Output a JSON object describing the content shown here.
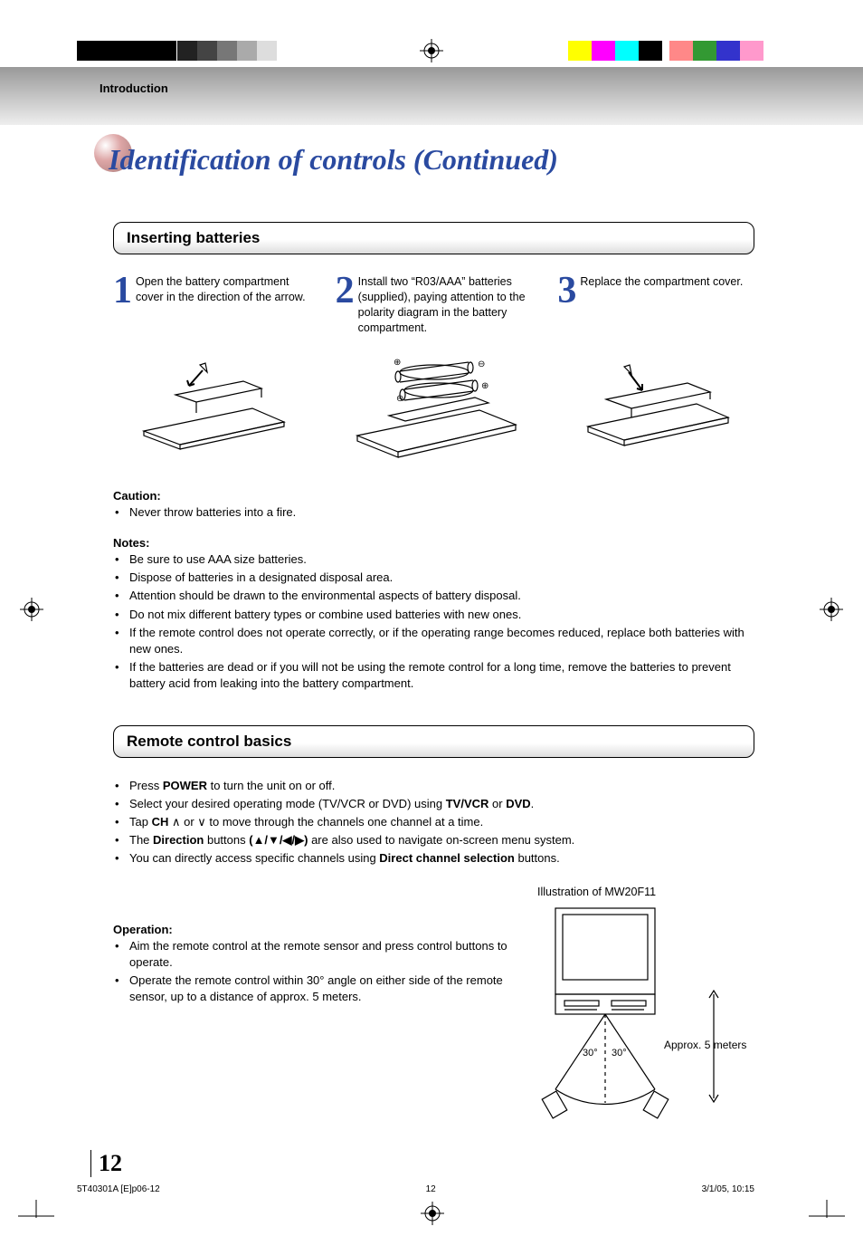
{
  "header_section": "Introduction",
  "title": "Identification of controls (Continued)",
  "section1_heading": "Inserting batteries",
  "steps": [
    {
      "num": "1",
      "text": "Open the battery compartment cover in the direction of the arrow."
    },
    {
      "num": "2",
      "text": "Install two “R03/AAA” batteries (supplied), paying attention to the polarity diagram in the battery compartment."
    },
    {
      "num": "3",
      "text": "Replace the compartment cover."
    }
  ],
  "caution_label": "Caution:",
  "caution_items": [
    "Never throw batteries into a fire."
  ],
  "notes_label": "Notes:",
  "notes_items": [
    "Be sure to use AAA size batteries.",
    "Dispose of batteries in a designated disposal area.",
    "Attention should be drawn to the environmental aspects of battery disposal.",
    "Do not mix different battery types or combine used batteries with new ones.",
    "If the remote control does not operate correctly, or if the operating range becomes reduced, replace both batteries with new ones.",
    "If the batteries are dead or if you will not be using the remote control for a long time, remove the batteries to prevent battery acid from leaking into the battery compartment."
  ],
  "section2_heading": "Remote control basics",
  "basics": {
    "b1_pre": "Press ",
    "b1_bold": "POWER",
    "b1_post": " to turn the unit on or off.",
    "b2_pre": "Select your desired operating mode (TV/VCR or DVD) using ",
    "b2_bold1": "TV/VCR",
    "b2_mid": " or ",
    "b2_bold2": "DVD",
    "b2_post": ".",
    "b3_pre": "Tap ",
    "b3_bold": "CH",
    "b3_post": " ∧ or ∨ to move through the channels one channel at a time.",
    "b4_pre": "The ",
    "b4_bold1": "Direction",
    "b4_mid1": " buttons ",
    "b4_bold2": "(▲/▼/◀/▶)",
    "b4_post": " are also used to navigate on-screen menu system.",
    "b5_pre": "You can directly access specific channels using ",
    "b5_bold": "Direct channel selection",
    "b5_post": " buttons."
  },
  "illus_caption": "Illustration of MW20F11",
  "illus_distance": "Approx. 5 meters",
  "illus_angle_l": "30°",
  "illus_angle_r": "30°",
  "operation_label": "Operation:",
  "operation_items": [
    "Aim the remote control at the remote sensor and press control buttons to operate.",
    "Operate the remote control within 30° angle on either side of the remote sensor, up to a distance of approx. 5 meters."
  ],
  "page_number": "12",
  "footer_left": "5T40301A [E]p06-12",
  "footer_center": "12",
  "footer_right": "3/1/05, 10:15"
}
